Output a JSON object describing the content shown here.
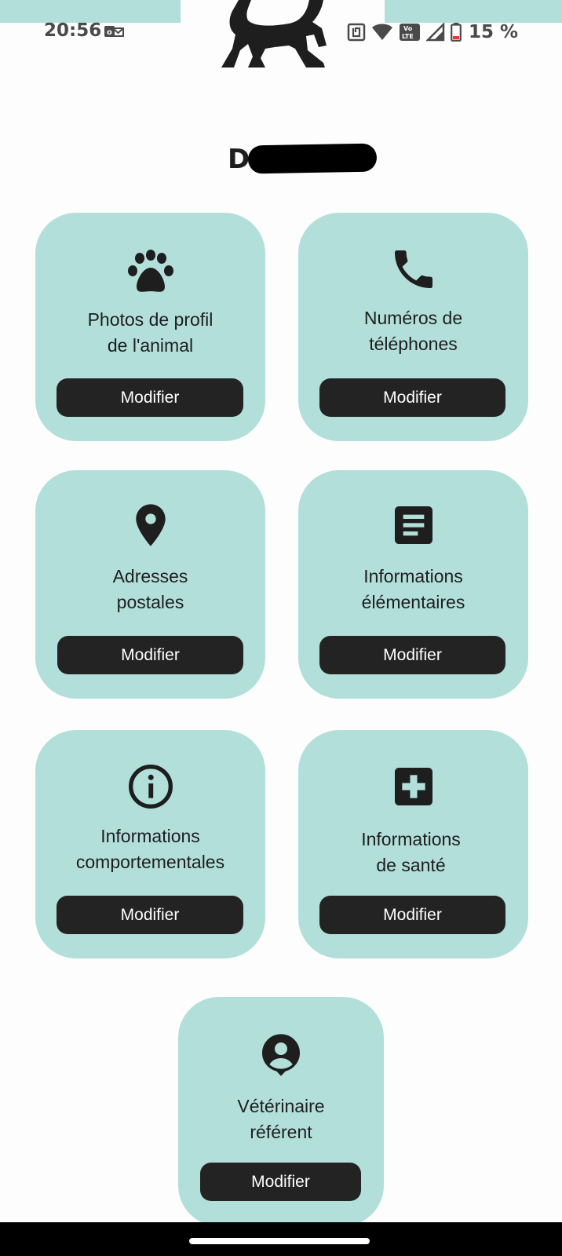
{
  "status_bar": {
    "time": "20:56",
    "battery_percent": "15 %",
    "icons": [
      "app-notification-icon",
      "nfc-icon",
      "wifi-icon",
      "volte-icon",
      "signal-icon",
      "battery-icon"
    ]
  },
  "header": {
    "logo": "dog-logo-icon",
    "pet_name_initial": "D"
  },
  "colors": {
    "card_bg": "#b2dfda",
    "button_bg": "#232323",
    "button_text": "#ffffff",
    "battery_low": "#e53935"
  },
  "cards": [
    {
      "icon": "paw-icon",
      "label_line1": "Photos de profil",
      "label_line2": "de l'animal",
      "button": "Modifier"
    },
    {
      "icon": "phone-icon",
      "label_line1": "Numéros de",
      "label_line2": "téléphones",
      "button": "Modifier"
    },
    {
      "icon": "location-pin-icon",
      "label_line1": "Adresses",
      "label_line2": "postales",
      "button": "Modifier"
    },
    {
      "icon": "document-icon",
      "label_line1": "Informations",
      "label_line2": "élémentaires",
      "button": "Modifier"
    },
    {
      "icon": "info-icon",
      "label_line1": "Informations",
      "label_line2": "comportementales",
      "button": "Modifier"
    },
    {
      "icon": "medical-cross-icon",
      "label_line1": "Informations",
      "label_line2": "de santé",
      "button": "Modifier"
    },
    {
      "icon": "veterinarian-person-icon",
      "label_line1": "Vétérinaire",
      "label_line2": "référent",
      "button": "Modifier"
    }
  ]
}
